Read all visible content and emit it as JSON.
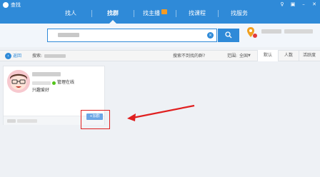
{
  "window": {
    "title": "查找",
    "controls": [
      "♀",
      "▣",
      "–",
      "✕"
    ]
  },
  "nav": {
    "items": [
      {
        "label": "找人",
        "active": false,
        "badge": false
      },
      {
        "label": "找群",
        "active": true,
        "badge": false
      },
      {
        "label": "找主播",
        "active": false,
        "badge": true
      },
      {
        "label": "找课程",
        "active": false,
        "badge": false
      },
      {
        "label": "找服务",
        "active": false,
        "badge": false
      }
    ]
  },
  "search": {
    "clear_icon": "×"
  },
  "filter": {
    "back_label": "返回",
    "search_prefix": "搜索:",
    "not_found": "搜索不到找的群?",
    "range_label": "范围:",
    "range_value": "全国",
    "range_caret": "▼",
    "sort_tabs": [
      {
        "label": "默认",
        "active": true
      },
      {
        "label": "人数",
        "active": false
      },
      {
        "label": "活跃度",
        "active": false
      }
    ]
  },
  "results": [
    {
      "online_text": "管理在线",
      "tag": "兴趣爱好",
      "add_label": "+加群"
    }
  ],
  "colors": {
    "brand": "#2f8ad8",
    "online": "#52c41a",
    "annotation": "#e02020"
  }
}
